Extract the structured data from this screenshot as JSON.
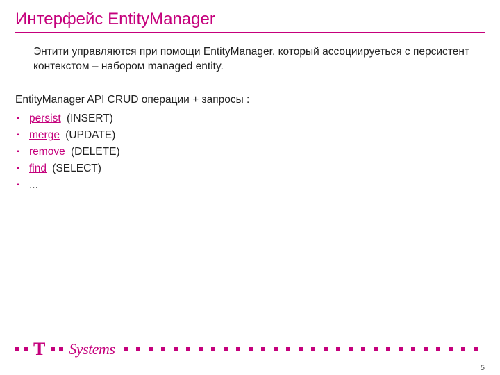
{
  "title": "Интерфейс EntityManager",
  "intro": "Энтити управляются при помощи EntityManager, который  ассоциируеться с персистент контекстом – набором  managed entity.",
  "api_line": "EntityManager API   CRUD операции + запросы :",
  "ops": [
    {
      "link": "persist",
      "rest": " (INSERT)"
    },
    {
      "link": "merge",
      "rest": " (UPDATE)"
    },
    {
      "link": "remove",
      "rest": " (DELETE)"
    },
    {
      "link": "find",
      "rest": " (SELECT)"
    },
    {
      "link": "",
      "rest": "..."
    }
  ],
  "logo": {
    "t": "T",
    "systems": "Systems"
  },
  "page_number": "5",
  "colors": {
    "brand": "#c5007c"
  }
}
